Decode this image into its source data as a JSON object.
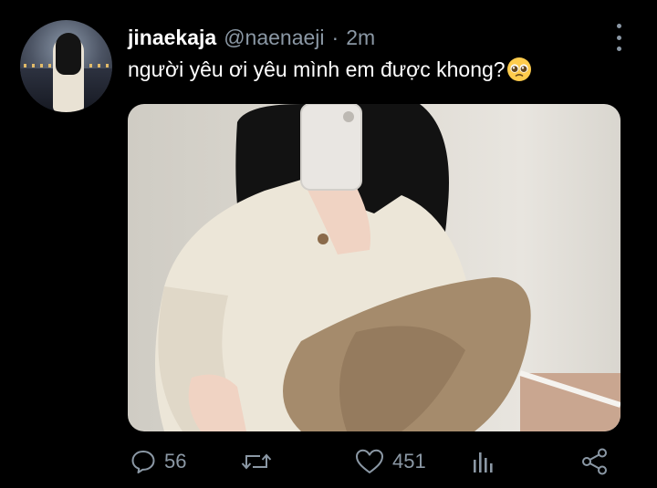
{
  "tweet": {
    "username": "jinaekaja",
    "handle": "@naenaeji",
    "separator": "·",
    "time": "2m",
    "text": "người yêu ơi yêu mình em được khong?",
    "emoji": "pleading-face"
  },
  "actions": {
    "replies": "56",
    "likes": "451"
  },
  "colors": {
    "background": "#000000",
    "text_primary": "#ffffff",
    "text_secondary": "#8b98a5"
  }
}
